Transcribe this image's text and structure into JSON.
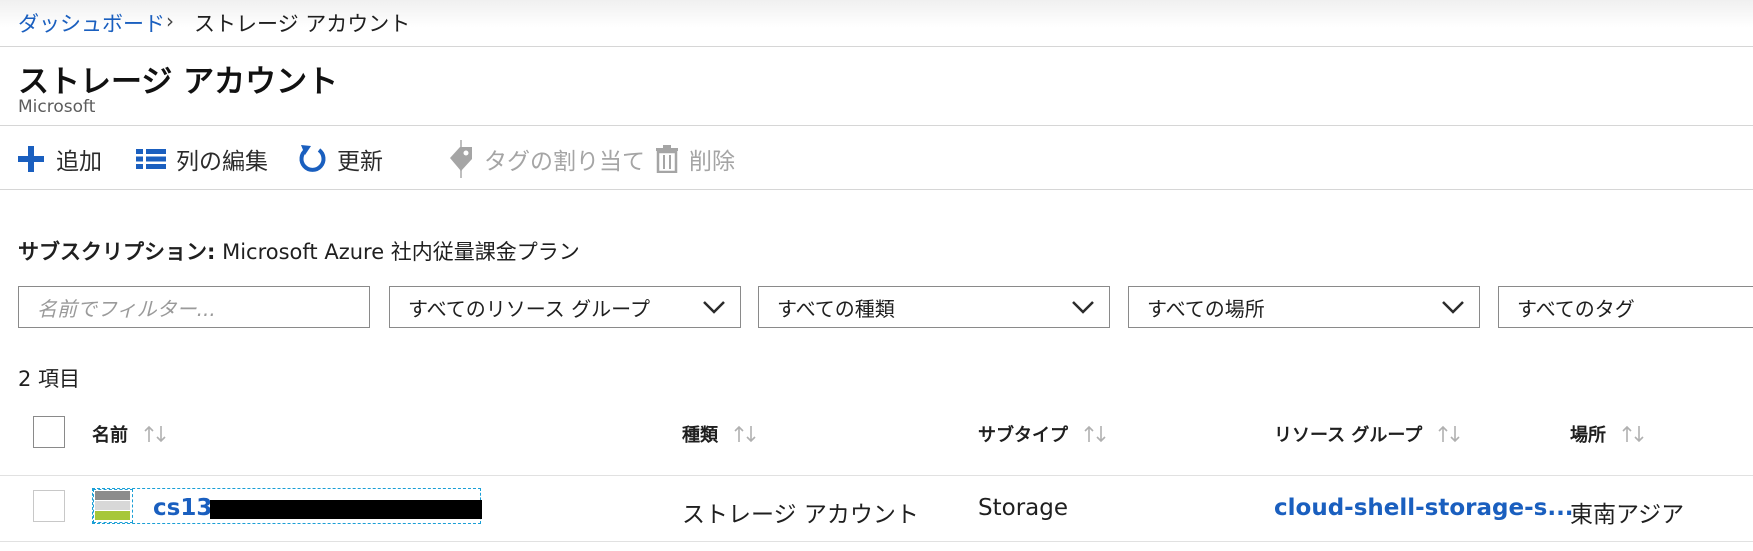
{
  "breadcrumb": {
    "home": "ダッシュボード",
    "separator": "›",
    "current": "ストレージ アカウント"
  },
  "page": {
    "title": "ストレージ アカウント",
    "subtitle": "Microsoft"
  },
  "toolbar": {
    "add": "追加",
    "edit_columns": "列の編集",
    "refresh": "更新",
    "assign_tags": "タグの割り当て",
    "delete": "削除"
  },
  "subscription": {
    "label": "サブスクリプション:",
    "value": "Microsoft Azure 社内従量課金プラン"
  },
  "filters": {
    "name_placeholder": "名前でフィルター...",
    "resource_group": "すべてのリソース グループ",
    "type": "すべての種類",
    "location": "すべての場所",
    "tags": "すべてのタグ"
  },
  "item_count": "2 項目",
  "table": {
    "headers": {
      "name": "名前",
      "type": "種類",
      "subtype": "サブタイプ",
      "resource_group": "リソース グループ",
      "location": "場所"
    },
    "rows": [
      {
        "name": "cs13",
        "type": "ストレージ アカウント",
        "subtype": "Storage",
        "resource_group": "cloud-shell-storage-s...",
        "location": "東南アジア"
      }
    ]
  },
  "colors": {
    "accent": "#1a5fbf",
    "focus": "#1a9fd6",
    "disabled": "#a5a5a5"
  }
}
